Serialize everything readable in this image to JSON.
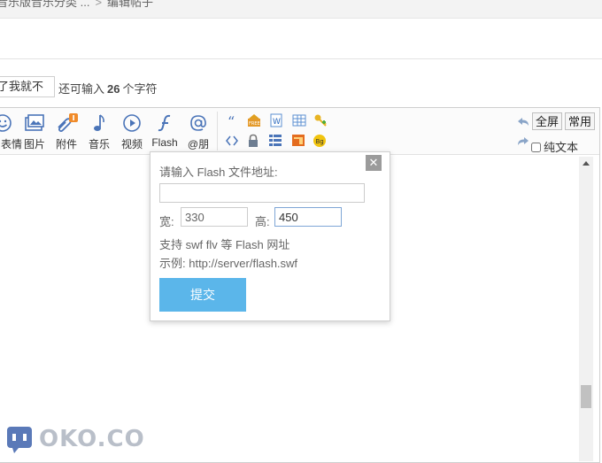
{
  "breadcrumb": {
    "items": [
      "音乐版音乐分类 ...",
      "编辑帖子"
    ]
  },
  "title_field": {
    "value": "了我就不",
    "remain_prefix": "还可输入",
    "remain_count": "26",
    "remain_suffix": "个字符"
  },
  "toolbar": {
    "big_buttons": [
      {
        "label": "表情",
        "icon": "smiley-icon"
      },
      {
        "label": "图片",
        "icon": "image-icon"
      },
      {
        "label": "附件",
        "icon": "attachment-icon"
      },
      {
        "label": "音乐",
        "icon": "music-icon"
      },
      {
        "label": "视频",
        "icon": "video-icon"
      },
      {
        "label": "Flash",
        "icon": "flash-icon"
      },
      {
        "label": "@朋",
        "icon": "at-icon"
      }
    ],
    "small_icons": [
      "quote-icon",
      "free-icon",
      "word-icon",
      "table-icon",
      "key-icon",
      "code-icon",
      "lock-icon",
      "list-icon",
      "window-icon",
      "bg-icon"
    ],
    "fullscreen_label": "全屏",
    "common_label": "常用",
    "plain_text_label": "纯文本"
  },
  "flash_dialog": {
    "prompt": "请输入 Flash 文件地址:",
    "url_value": "",
    "width_label": "宽:",
    "width_value": "330",
    "height_label": "高:",
    "height_value": "450",
    "support_text": "支持 swf flv 等 Flash 网址",
    "example_text": "示例: http://server/flash.swf",
    "submit_label": "提交",
    "close_glyph": "✕"
  },
  "watermark": {
    "text": "OKO.CO"
  },
  "colors": {
    "accent": "#5bb6ea",
    "link_icon": "#4a74b8",
    "attach_badge": "#f08b2a"
  }
}
